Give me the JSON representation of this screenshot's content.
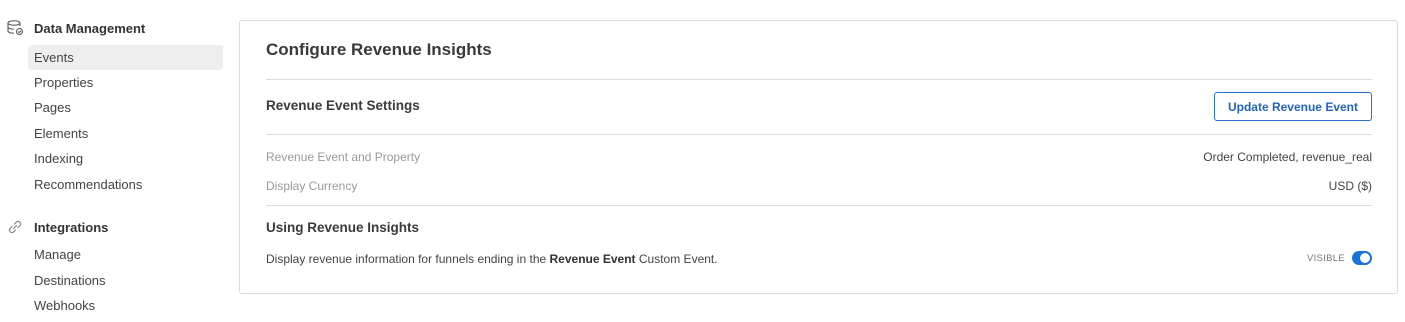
{
  "sidebar": {
    "data_management": {
      "label": "Data Management",
      "icon": "database-icon",
      "items": [
        "Events",
        "Properties",
        "Pages",
        "Elements",
        "Indexing",
        "Recommendations"
      ],
      "active": "Events"
    },
    "integrations": {
      "label": "Integrations",
      "icon": "link-icon",
      "items": [
        "Manage",
        "Destinations",
        "Webhooks"
      ]
    }
  },
  "panel": {
    "title": "Configure Revenue Insights",
    "settings_title": "Revenue Event Settings",
    "update_button": "Update Revenue Event",
    "rows": [
      {
        "label": "Revenue Event and Property",
        "value": "Order Completed, revenue_real"
      },
      {
        "label": "Display Currency",
        "value": "USD ($)"
      }
    ],
    "using_title": "Using Revenue Insights",
    "description": {
      "before": "Display revenue information for funnels ending in the ",
      "bold": "Revenue Event",
      "after": " Custom Event."
    },
    "visible_label": "VISIBLE",
    "visible_on": true
  },
  "colors": {
    "accent": "#1a73d9",
    "active_bg": "#eeeeee",
    "border": "#dcdcdc"
  }
}
